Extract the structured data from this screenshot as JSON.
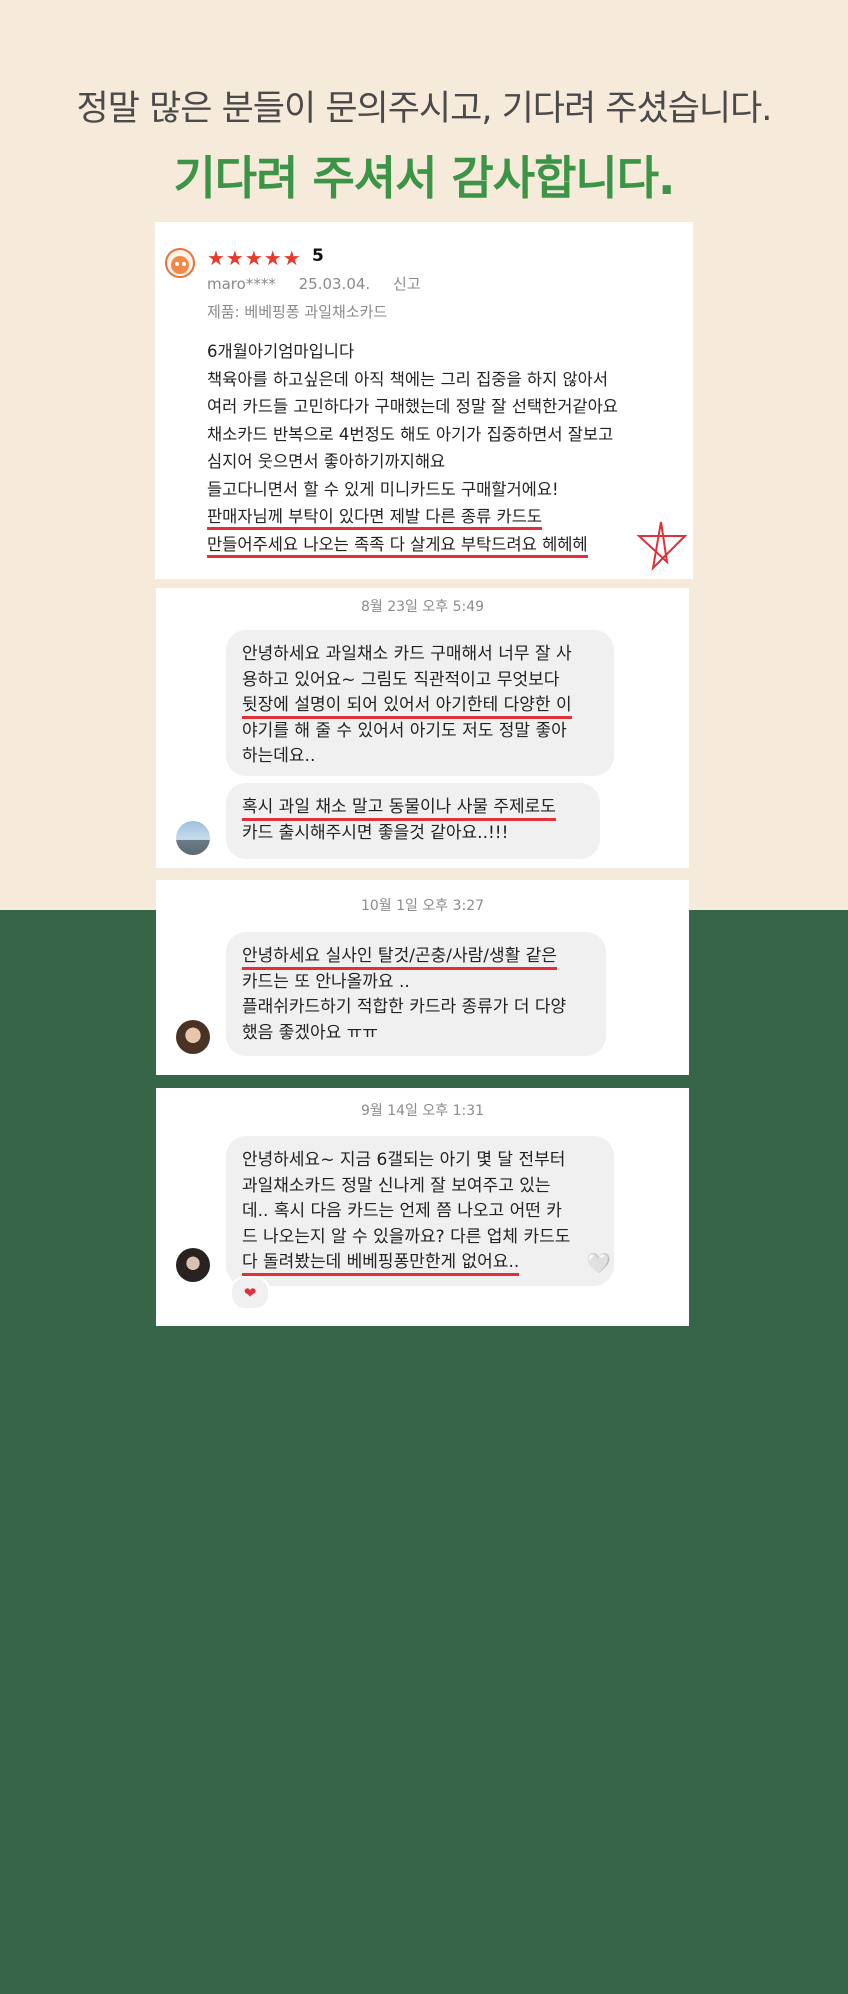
{
  "header": {
    "line1": "정말 많은 분들이 문의주시고, 기다려 주셨습니다.",
    "line2": "기다려 주셔서 감사합니다."
  },
  "review": {
    "stars": "★★★★★",
    "score": "5",
    "user": "maro****",
    "date": "25.03.04.",
    "report": "신고",
    "product": "제품: 베베핑퐁 과일채소카드",
    "lines": [
      "6개월아기엄마입니다",
      "책육아를 하고싶은데 아직 책에는 그리 집중을 하지 않아서",
      "여러 카드들 고민하다가 구매했는데 정말 잘 선택한거같아요",
      "채소카드 반복으로 4번정도 해도 아기가 집중하면서 잘보고",
      "심지어 웃으면서 좋아하기까지해요",
      "들고다니면서 할 수 있게 미니카드도 구매할거에요!",
      "판매자님께 부탁이 있다면 제발 다른 종류 카드도",
      "만들어주세요 나오는 족족 다 살게요 부탁드려요 헤헤헤"
    ]
  },
  "chat1": {
    "timestamp": "8월 23일 오후 5:49",
    "bubble1": [
      "안녕하세요 과일채소 카드 구매해서 너무 잘 사",
      "용하고 있어요~ 그림도 직관적이고 무엇보다",
      "뒷장에 설명이 되어 있어서 아기한테 다양한 이",
      "야기를 해 줄 수 있어서 아기도 저도 정말 좋아",
      "하는데요.."
    ],
    "bubble2": [
      "혹시 과일 채소 말고 동물이나 사물 주제로도",
      "카드 출시해주시면 좋을것 같아요..!!!"
    ]
  },
  "chat2": {
    "timestamp": "10월 1일 오후 3:27",
    "bubble": [
      "안녕하세요 실사인 탈것/곤충/사람/생활 같은",
      "카드는 또 안나올까요 ..",
      "플래쉬카드하기 적합한 카드라 종류가 더 다양",
      "했음 좋겠아요 ㅠㅠ"
    ]
  },
  "chat3": {
    "timestamp": "9월 14일 오후 1:31",
    "bubble": [
      "안녕하세요~ 지금 6갤되는 아기 몇 달 전부터",
      "과일채소카드 정말 신나게 잘 보여주고 있는",
      "데.. 혹시 다음 카드는 언제 쯤 나오고 어떤 카",
      "드 나오는지 알 수 있을까요? 다른 업체 카드도",
      "다 돌려봤는데 베베핑퐁만한게 없어요.."
    ],
    "white_heart": "🤍",
    "reaction": "❤"
  }
}
